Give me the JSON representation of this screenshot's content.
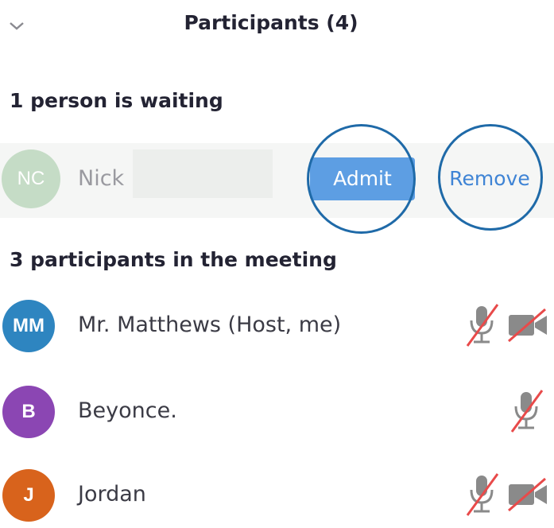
{
  "header": {
    "title": "Participants (4)",
    "collapse_icon": "chevron-down-icon"
  },
  "waiting_room": {
    "heading": "1 person is waiting",
    "person": {
      "initials": "NC",
      "name": "Nick",
      "avatar_color": "#c5dcc6"
    },
    "admit_label": "Admit",
    "remove_label": "Remove"
  },
  "meeting": {
    "heading": "3 participants in the meeting",
    "participants": [
      {
        "initials": "MM",
        "name": "Mr. Matthews (Host, me)",
        "avatar_color": "#2e85c0",
        "mic": "muted",
        "video": "off"
      },
      {
        "initials": "B",
        "name": "Beyonce.",
        "avatar_color": "#8b46b3",
        "mic": "muted"
      },
      {
        "initials": "J",
        "name": "Jordan",
        "avatar_color": "#d8631c",
        "mic": "muted",
        "video": "off"
      }
    ]
  },
  "colors": {
    "admit_button": "#5d9ee3",
    "remove_link": "#3f84d5",
    "annotation_ring": "#1f6aa8",
    "muted_slash": "#e84a4a",
    "icon_gray": "#8a8a8a"
  }
}
